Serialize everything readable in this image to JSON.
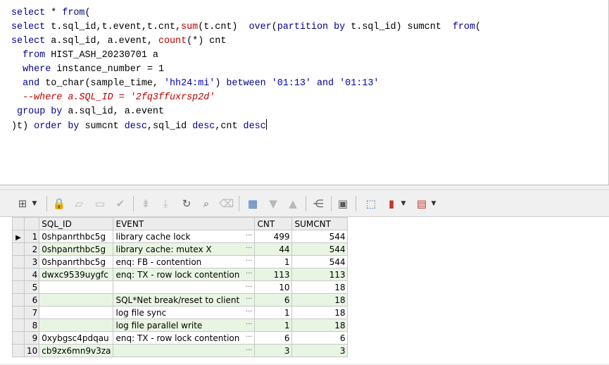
{
  "editor": {
    "lines": [
      [
        {
          "t": "select",
          "c": "kw"
        },
        {
          "t": " * "
        },
        {
          "t": "from",
          "c": "kw"
        },
        {
          "t": "("
        }
      ],
      [
        {
          "t": "select",
          "c": "kw"
        },
        {
          "t": " t.sql_id,t.event,t.cnt,"
        },
        {
          "t": "sum",
          "c": "fn"
        },
        {
          "t": "(t.cnt)  "
        },
        {
          "t": "over",
          "c": "kw"
        },
        {
          "t": "("
        },
        {
          "t": "partition by",
          "c": "kw"
        },
        {
          "t": " t.sql_id) sumcnt  "
        },
        {
          "t": "from",
          "c": "kw"
        },
        {
          "t": "("
        }
      ],
      [
        {
          "t": "select",
          "c": "kw"
        },
        {
          "t": " a.sql_id, a.event, "
        },
        {
          "t": "count",
          "c": "fn"
        },
        {
          "t": "(*) cnt"
        }
      ],
      [
        {
          "t": "  "
        },
        {
          "t": "from",
          "c": "kw"
        },
        {
          "t": " HIST_ASH_20230701 a"
        }
      ],
      [
        {
          "t": "  "
        },
        {
          "t": "where",
          "c": "kw"
        },
        {
          "t": " instance_number = 1"
        }
      ],
      [
        {
          "t": "  "
        },
        {
          "t": "and",
          "c": "kw"
        },
        {
          "t": " to_char(sample_time, "
        },
        {
          "t": "'hh24:mi'",
          "c": "str"
        },
        {
          "t": ") "
        },
        {
          "t": "between",
          "c": "kw"
        },
        {
          "t": " "
        },
        {
          "t": "'01:13'",
          "c": "str"
        },
        {
          "t": " "
        },
        {
          "t": "and",
          "c": "kw"
        },
        {
          "t": " "
        },
        {
          "t": "'01:13'",
          "c": "str"
        }
      ],
      [
        {
          "t": "  --where a.SQL_ID = '2fq3ffuxrsp2d'",
          "c": "cm"
        }
      ],
      [
        {
          "t": " "
        },
        {
          "t": "group by",
          "c": "kw"
        },
        {
          "t": " a.sql_id, a.event"
        }
      ],
      [
        {
          "t": ")t) "
        },
        {
          "t": "order by",
          "c": "kw"
        },
        {
          "t": " sumcnt "
        },
        {
          "t": "desc",
          "c": "kw"
        },
        {
          "t": ",sql_id "
        },
        {
          "t": "desc",
          "c": "kw"
        },
        {
          "t": ",cnt "
        },
        {
          "t": "desc",
          "c": "kw"
        }
      ]
    ]
  },
  "toolbar": {
    "buttons": [
      {
        "name": "grid-options-icon",
        "glyph": "⊞"
      },
      {
        "name": "lock-icon",
        "glyph": "🔒"
      },
      {
        "name": "insert-record-icon",
        "glyph": "▱"
      },
      {
        "name": "delete-record-icon",
        "glyph": "▭"
      },
      {
        "name": "post-changes-icon",
        "glyph": "✔"
      },
      {
        "name": "fetch-next-icon",
        "glyph": "⇟"
      },
      {
        "name": "fetch-last-icon",
        "glyph": "⤓"
      },
      {
        "name": "refresh-icon",
        "glyph": "↻"
      },
      {
        "name": "find-icon",
        "glyph": "⌕"
      },
      {
        "name": "clear-icon",
        "glyph": "⌫"
      },
      {
        "name": "query-by-example-icon",
        "glyph": "▦"
      },
      {
        "name": "filter-icon",
        "glyph": "▼"
      },
      {
        "name": "sort-icon",
        "glyph": "▲"
      },
      {
        "name": "connect-icon",
        "glyph": "⋲"
      },
      {
        "name": "save-icon",
        "glyph": "💾"
      },
      {
        "name": "export-icon",
        "glyph": "⬚"
      },
      {
        "name": "chart-icon",
        "glyph": "▮"
      },
      {
        "name": "table-view-icon",
        "glyph": "▤"
      }
    ]
  },
  "grid": {
    "columns": [
      "SQL_ID",
      "EVENT",
      "CNT",
      "SUMCNT"
    ],
    "rows": [
      {
        "n": "1",
        "sql_id": "0shpanrthbc5g",
        "event": "library cache lock",
        "cnt": "499",
        "sumcnt": "544"
      },
      {
        "n": "2",
        "sql_id": "0shpanrthbc5g",
        "event": "library cache: mutex X",
        "cnt": "44",
        "sumcnt": "544"
      },
      {
        "n": "3",
        "sql_id": "0shpanrthbc5g",
        "event": "enq: FB - contention",
        "cnt": "1",
        "sumcnt": "544"
      },
      {
        "n": "4",
        "sql_id": "dwxc9539uygfc",
        "event": "enq: TX - row lock contention",
        "cnt": "113",
        "sumcnt": "113"
      },
      {
        "n": "5",
        "sql_id": "",
        "event": "",
        "cnt": "10",
        "sumcnt": "18"
      },
      {
        "n": "6",
        "sql_id": "",
        "event": "SQL*Net break/reset to client",
        "cnt": "6",
        "sumcnt": "18"
      },
      {
        "n": "7",
        "sql_id": "",
        "event": "log file sync",
        "cnt": "1",
        "sumcnt": "18"
      },
      {
        "n": "8",
        "sql_id": "",
        "event": "log file parallel write",
        "cnt": "1",
        "sumcnt": "18"
      },
      {
        "n": "9",
        "sql_id": "0xybgsc4pdqau",
        "event": "enq: TX - row lock contention",
        "cnt": "6",
        "sumcnt": "6"
      },
      {
        "n": "10",
        "sql_id": "cb9zx6mn9v3za",
        "event": "",
        "cnt": "3",
        "sumcnt": "3"
      }
    ],
    "ellipsis": "···",
    "current_row_marker": "▶"
  }
}
